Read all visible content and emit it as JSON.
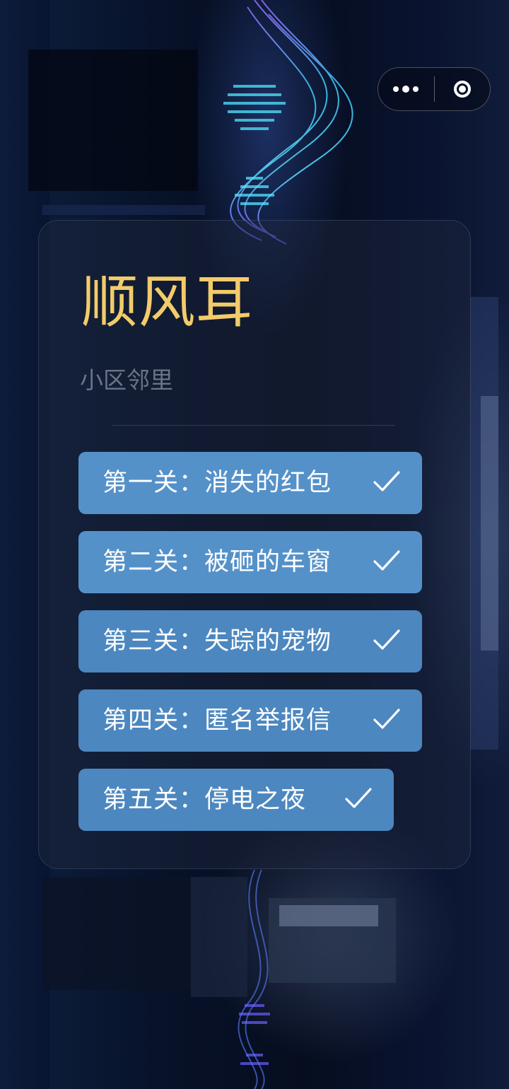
{
  "app": {
    "title": "顺风耳",
    "subtitle": "小区邻里"
  },
  "capsule": {
    "more_icon": "more-dots-icon",
    "close_icon": "target-circle-icon"
  },
  "levels": [
    {
      "label": "第一关：消失的红包",
      "completed": true,
      "icon": "check-icon"
    },
    {
      "label": "第二关：被砸的车窗",
      "completed": true,
      "icon": "check-icon"
    },
    {
      "label": "第三关：失踪的宠物",
      "completed": true,
      "icon": "check-icon"
    },
    {
      "label": "第四关：匿名举报信",
      "completed": true,
      "icon": "check-icon"
    },
    {
      "label": "第五关：停电之夜",
      "completed": true,
      "icon": "check-icon"
    }
  ],
  "colors": {
    "title": "#f3cb6a",
    "subtitle": "#6b7486",
    "level_button": "#4c87c0",
    "level_button_light": "#5591c9",
    "background": "#060a18"
  }
}
